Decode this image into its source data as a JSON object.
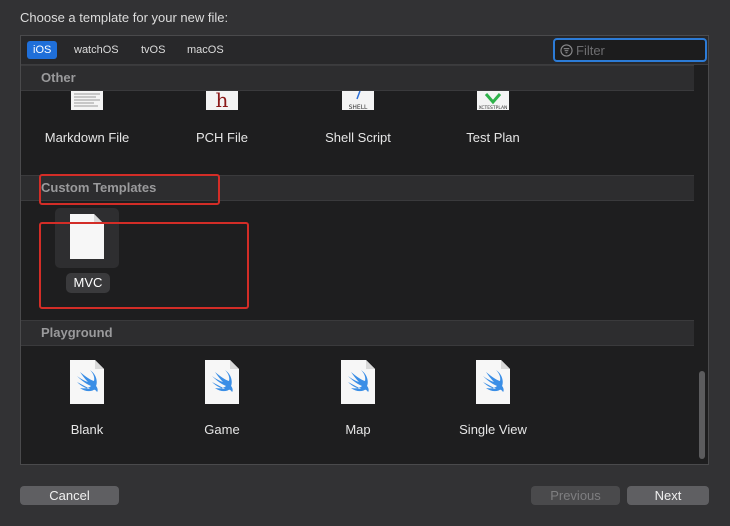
{
  "dialog": {
    "title": "Choose a template for your new file:"
  },
  "tabs": [
    "iOS",
    "watchOS",
    "tvOS",
    "macOS"
  ],
  "active_tab": "iOS",
  "filter": {
    "placeholder": "Filter",
    "value": ""
  },
  "sections": {
    "other": {
      "header": "Other",
      "items": [
        {
          "label": "Markdown File",
          "icon": "markdown-file-icon"
        },
        {
          "label": "PCH File",
          "icon": "pch-file-icon",
          "glyph": "h"
        },
        {
          "label": "Shell Script",
          "icon": "shell-script-icon",
          "glyph": "SHELL"
        },
        {
          "label": "Test Plan",
          "icon": "test-plan-icon",
          "glyph": "XCTESTPLAN"
        }
      ]
    },
    "custom": {
      "header": "Custom Templates",
      "items": [
        {
          "label": "MVC",
          "icon": "blank-document-icon",
          "selected": true
        }
      ]
    },
    "playground": {
      "header": "Playground",
      "items": [
        {
          "label": "Blank",
          "icon": "swift-file-icon"
        },
        {
          "label": "Game",
          "icon": "swift-file-icon"
        },
        {
          "label": "Map",
          "icon": "swift-file-icon"
        },
        {
          "label": "Single View",
          "icon": "swift-file-icon"
        }
      ]
    }
  },
  "buttons": {
    "cancel": "Cancel",
    "previous": "Previous",
    "next": "Next"
  },
  "colors": {
    "accent": "#1f6fd9",
    "highlight": "#d32d27",
    "swift": "#3a8ee6",
    "pch": "#8b1a1a"
  }
}
